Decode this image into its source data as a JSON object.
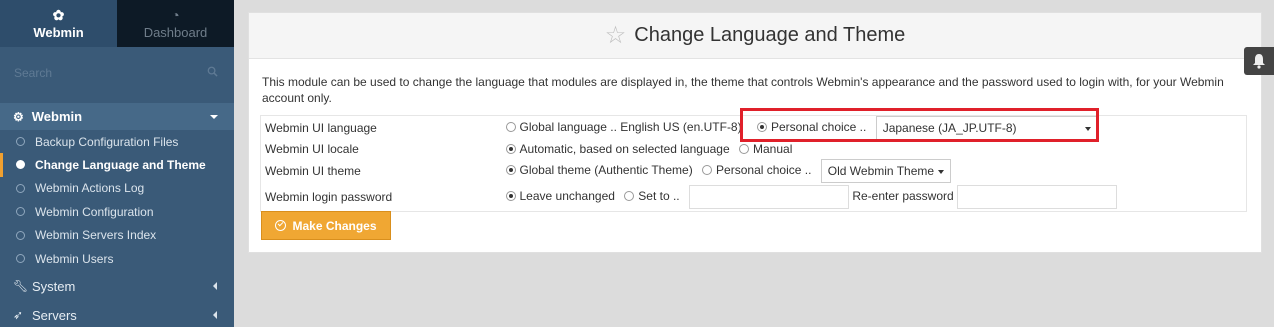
{
  "sidebar": {
    "tabs": {
      "webmin": "Webmin",
      "dashboard": "Dashboard"
    },
    "search_placeholder": "Search",
    "category_webmin": "Webmin",
    "items": [
      {
        "label": "Backup Configuration Files",
        "active": false
      },
      {
        "label": "Change Language and Theme",
        "active": true
      },
      {
        "label": "Webmin Actions Log",
        "active": false
      },
      {
        "label": "Webmin Configuration",
        "active": false
      },
      {
        "label": "Webmin Servers Index",
        "active": false
      },
      {
        "label": "Webmin Users",
        "active": false
      }
    ],
    "category_system": "System",
    "category_servers": "Servers"
  },
  "page": {
    "title": "Change Language and Theme",
    "description": "This module can be used to change the language that modules are displayed in, the theme that controls Webmin's appearance and the password used to login with, for your Webmin account only."
  },
  "form": {
    "language": {
      "label": "Webmin UI language",
      "global_option": "Global language .. English US (en.UTF-8)",
      "personal_option": "Personal choice ..",
      "selected": "Japanese (JA_JP.UTF-8)"
    },
    "locale": {
      "label": "Webmin UI locale",
      "auto_option": "Automatic, based on selected language",
      "manual_option": "Manual"
    },
    "theme": {
      "label": "Webmin UI theme",
      "global_option": "Global theme (Authentic Theme)",
      "personal_option": "Personal choice ..",
      "selected": "Old Webmin Theme"
    },
    "password": {
      "label": "Webmin login password",
      "unchanged_option": "Leave unchanged",
      "setto_option": "Set to ..",
      "reenter_label": "Re-enter password"
    },
    "submit_label": "Make Changes"
  },
  "colors": {
    "sidebar_bg": "#3a5a78",
    "accent": "#f0a733",
    "highlight_box": "#e0202a"
  }
}
